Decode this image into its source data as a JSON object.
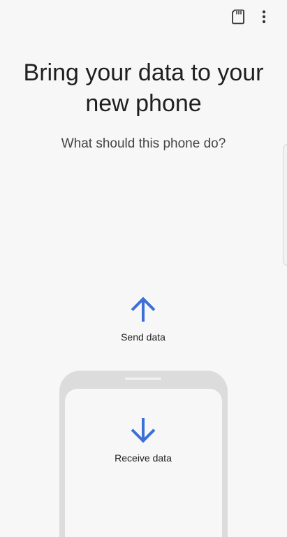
{
  "toolbar": {
    "sd_card_icon": "sd-card-icon",
    "more_icon": "more-vert-icon"
  },
  "main": {
    "title_line1": "Bring your data to your",
    "title_line2": "new phone",
    "subtitle": "What should this phone do?"
  },
  "options": {
    "send_label": "Send data",
    "send_icon": "arrow-up-icon",
    "receive_label": "Receive data",
    "receive_icon": "arrow-down-icon"
  },
  "colors": {
    "accent": "#3c6fd8",
    "background": "#f7f7f7",
    "phone_frame": "#dcdcdc"
  }
}
